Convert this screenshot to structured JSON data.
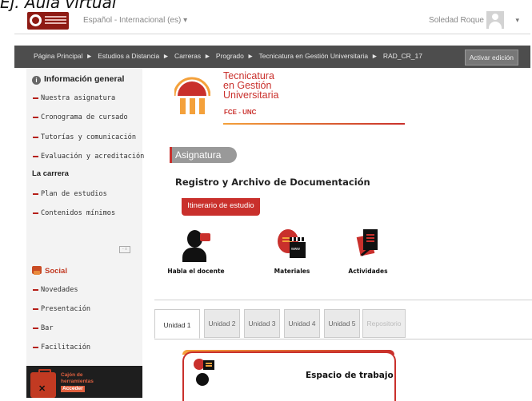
{
  "caption": "Ej. Aula virtual",
  "header": {
    "language": "Español - Internacional (es) ▾",
    "user_name": "Soledad Roque",
    "user_menu_caret": "▾"
  },
  "breadcrumb": {
    "items": [
      "Página Principal",
      "Estudios a Distancia",
      "Carreras",
      "Progrado",
      "Tecnicatura en Gestión Universitaria",
      "RAD_CR_17"
    ],
    "separator": "►",
    "edit_button": "Activar edición"
  },
  "sidebar": {
    "general_heading": "Información general",
    "general_items": [
      "Nuestra asignatura",
      "Cronograma de cursado",
      "Tutorías y comunicación",
      "Evaluación y acreditación"
    ],
    "career_heading": "La carrera",
    "career_items": [
      "Plan de estudios",
      "Contenidos mínimos"
    ],
    "social_heading": "Social",
    "social_items": [
      "Novedades",
      "Presentación",
      "Bar",
      "Facilitación"
    ],
    "toolbox_text": "Cajón de herramientas",
    "toolbox_badge": "Acceder"
  },
  "main": {
    "program_name_lines": [
      "Tecnicatura",
      "en Gestión",
      "Universitaria"
    ],
    "program_sub": "FCE - UNC",
    "section_label": "Asignatura",
    "course_title": "Registro y Archivo de Documentación",
    "itinerary_label": "Itinerario de estudio",
    "icon_buttons": [
      {
        "label": "Habla el docente",
        "icon": "teacher-speaks-icon"
      },
      {
        "label": "Materiales",
        "icon": "materials-icon"
      },
      {
        "label": "Actividades",
        "icon": "activities-icon"
      }
    ],
    "tabs": [
      "Unidad 1",
      "Unidad 2",
      "Unidad 3",
      "Unidad 4",
      "Unidad 5",
      "Repositorio"
    ],
    "active_tab": "Unidad 1",
    "workspace_title": "Espacio de trabajo"
  },
  "colors": {
    "brand_red": "#c9302c",
    "brand_orange": "#f4a13b",
    "breadcrumb_bg": "#4d4d4d",
    "sidebar_bg": "#f3f3f3"
  }
}
